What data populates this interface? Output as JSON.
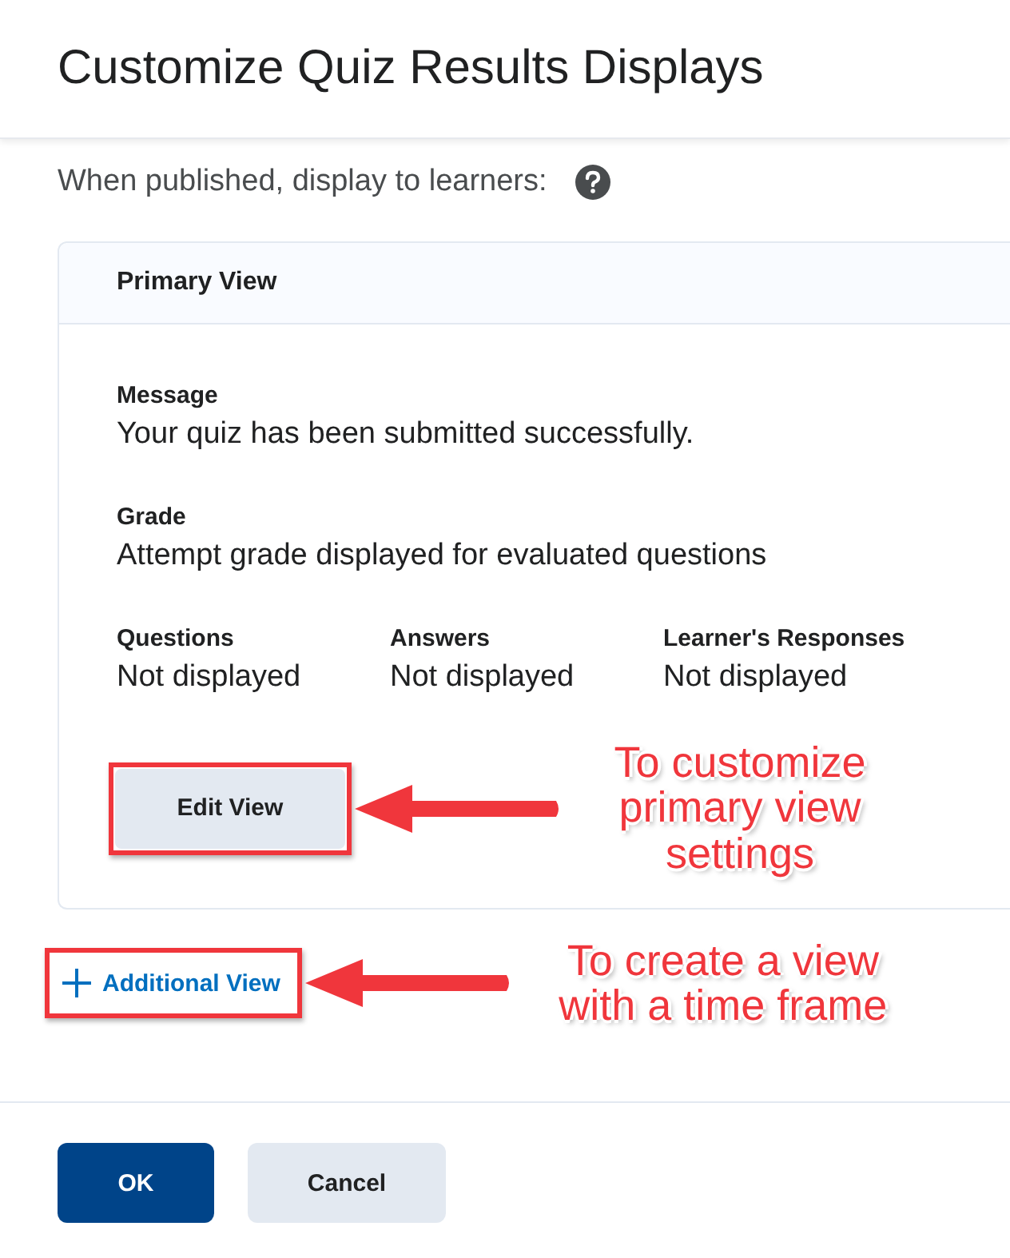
{
  "dialog": {
    "title": "Customize Quiz Results Displays"
  },
  "intro": {
    "text": "When published, display to learners:"
  },
  "card": {
    "title": "Primary View",
    "fields": [
      {
        "label": "Message",
        "value": "Your quiz has been submitted successfully."
      },
      {
        "label": "Grade",
        "value": "Attempt grade displayed for evaluated questions"
      }
    ],
    "columns": [
      {
        "label": "Questions",
        "value": "Not displayed"
      },
      {
        "label": "Answers",
        "value": "Not displayed"
      },
      {
        "label": "Learner's Responses",
        "value": "Not displayed"
      }
    ],
    "edit_button": "Edit View"
  },
  "add_link": "Additional View",
  "buttons": [
    {
      "label": "OK",
      "kind": "primary"
    },
    {
      "label": "Cancel",
      "kind": "secondary"
    }
  ],
  "annotations": [
    {
      "text": "To customize primary view settings"
    },
    {
      "text": "To create a view with a time frame"
    }
  ]
}
